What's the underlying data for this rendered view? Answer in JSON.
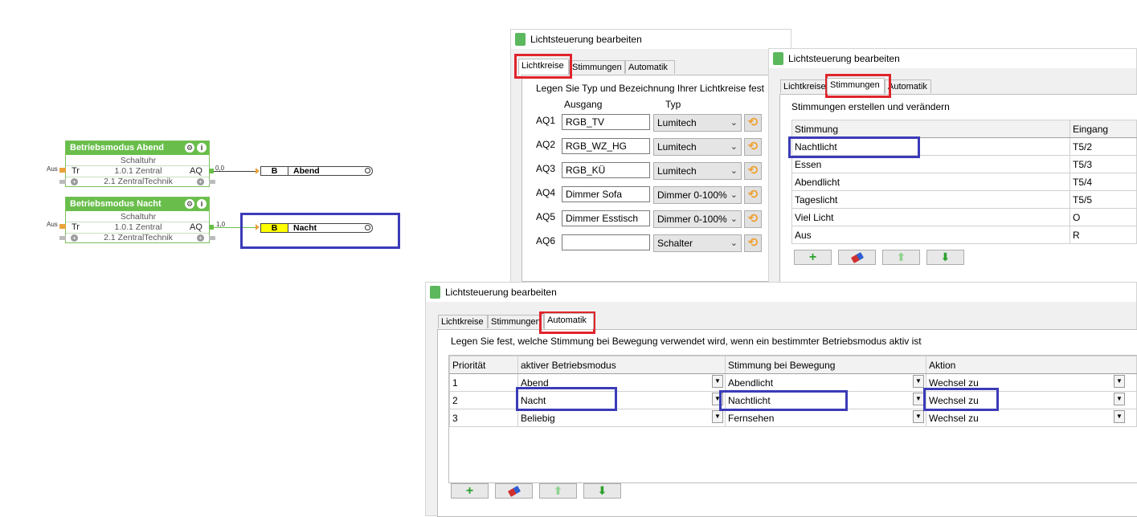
{
  "fblocks": [
    {
      "title": "Betriebsmodus Abend",
      "subtitle": "Schaltuhr",
      "line1": "1.0.1 Zentral",
      "line2": "2.1 ZentralTechnik",
      "pin_tr": "Tr",
      "pin_aq": "AQ",
      "in_label": "Aus",
      "out_value": "0,0",
      "settings_icon": "gear-icon",
      "info_icon": "info-icon"
    },
    {
      "title": "Betriebsmodus Nacht",
      "subtitle": "Schaltuhr",
      "line1": "1.0.1 Zentral",
      "line2": "2.1 ZentralTechnik",
      "pin_tr": "Tr",
      "pin_aq": "AQ",
      "in_label": "Aus",
      "out_value": "1,0",
      "settings_icon": "gear-icon",
      "info_icon": "info-icon"
    }
  ],
  "outblocks": [
    {
      "type": "B",
      "name": "Abend",
      "active": false
    },
    {
      "type": "B",
      "name": "Nacht",
      "active": true
    }
  ],
  "dialog1": {
    "title": "Lichtsteuerung bearbeiten",
    "tabs": [
      "Lichtkreise",
      "Stimmungen",
      "Automatik"
    ],
    "active_tab": "Lichtkreise",
    "heading": "Legen Sie Typ und Bezeichnung Ihrer Lichtkreise fest",
    "col_ausgang": "Ausgang",
    "col_typ": "Typ",
    "rows": [
      {
        "out": "AQ1",
        "name": "RGB_TV",
        "typ": "Lumitech"
      },
      {
        "out": "AQ2",
        "name": "RGB_WZ_HG",
        "typ": "Lumitech"
      },
      {
        "out": "AQ3",
        "name": "RGB_KÜ",
        "typ": "Lumitech"
      },
      {
        "out": "AQ4",
        "name": "Dimmer Sofa",
        "typ": "Dimmer 0-100%"
      },
      {
        "out": "AQ5",
        "name": "Dimmer Esstisch",
        "typ": "Dimmer 0-100%"
      },
      {
        "out": "AQ6",
        "name": "",
        "typ": "Schalter"
      }
    ]
  },
  "dialog2": {
    "title": "Lichtsteuerung bearbeiten",
    "tabs": [
      "Lichtkreise",
      "Stimmungen",
      "Automatik"
    ],
    "active_tab": "Stimmungen",
    "heading": "Stimmungen erstellen und verändern",
    "columns": [
      "Stimmung",
      "Eingang"
    ],
    "rows": [
      [
        "Nachtlicht",
        "T5/2"
      ],
      [
        "Essen",
        "T5/3"
      ],
      [
        "Abendlicht",
        "T5/4"
      ],
      [
        "Tageslicht",
        "T5/5"
      ],
      [
        "Viel Licht",
        "O"
      ],
      [
        "Aus",
        "R"
      ]
    ]
  },
  "dialog3": {
    "title": "Lichtsteuerung bearbeiten",
    "tabs": [
      "Lichtkreise",
      "Stimmungen",
      "Automatik"
    ],
    "active_tab": "Automatik",
    "heading": "Legen Sie fest, welche Stimmung bei Bewegung verwendet wird, wenn ein bestimmter Betriebsmodus aktiv ist",
    "columns": [
      "Priorität",
      "aktiver Betriebsmodus",
      "Stimmung bei Bewegung",
      "Aktion"
    ],
    "rows": [
      [
        "1",
        "Abend",
        "Abendlicht",
        "Wechsel zu"
      ],
      [
        "2",
        "Nacht",
        "Nachtlicht",
        "Wechsel zu"
      ],
      [
        "3",
        "Beliebig",
        "Fernsehen",
        "Wechsel zu"
      ]
    ]
  },
  "colors": {
    "block_green": "#69be4b",
    "highlight_blue": "#3b3bb8",
    "highlight_red": "#e0242c",
    "active_output": "#ffff00"
  }
}
